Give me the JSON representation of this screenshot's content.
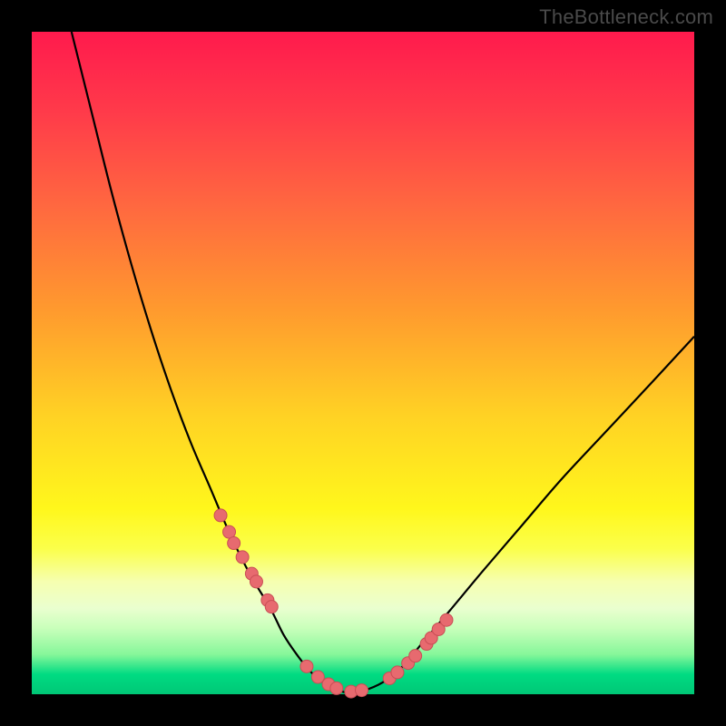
{
  "watermark": "TheBottleneck.com",
  "colors": {
    "dot_fill": "#e76a6f",
    "dot_stroke": "#c94e55",
    "curve": "#000000",
    "frame": "#000000"
  },
  "chart_data": {
    "type": "line",
    "title": "",
    "xlabel": "",
    "ylabel": "",
    "xlim": [
      0,
      100
    ],
    "ylim": [
      0,
      100
    ],
    "series": [
      {
        "name": "bottleneck-curve",
        "x": [
          6,
          9,
          12,
          15,
          18,
          21,
          24,
          27,
          30,
          33,
          36,
          38,
          40,
          42,
          44,
          46,
          48,
          50,
          53,
          56,
          59,
          63,
          68,
          74,
          80,
          87,
          94,
          100
        ],
        "y": [
          100,
          88,
          76,
          65,
          55,
          46,
          38,
          31,
          24,
          18,
          13,
          9,
          6,
          3.5,
          1.8,
          0.7,
          0.2,
          0.5,
          1.8,
          4.2,
          7.8,
          12.5,
          18.5,
          25.5,
          32.5,
          40,
          47.5,
          54
        ]
      }
    ],
    "markers": {
      "name": "highlighted-points",
      "x": [
        28.5,
        29.8,
        30.5,
        31.8,
        33.2,
        33.9,
        35.6,
        36.2,
        41.5,
        43.2,
        44.8,
        46.0,
        48.2,
        49.8,
        54.0,
        55.2,
        56.8,
        57.9,
        59.6,
        60.3,
        61.4,
        62.6
      ],
      "y": [
        27.0,
        24.5,
        22.8,
        20.7,
        18.2,
        17.0,
        14.2,
        13.2,
        4.2,
        2.6,
        1.5,
        0.9,
        0.4,
        0.6,
        2.4,
        3.3,
        4.7,
        5.8,
        7.6,
        8.5,
        9.8,
        11.2
      ]
    }
  }
}
